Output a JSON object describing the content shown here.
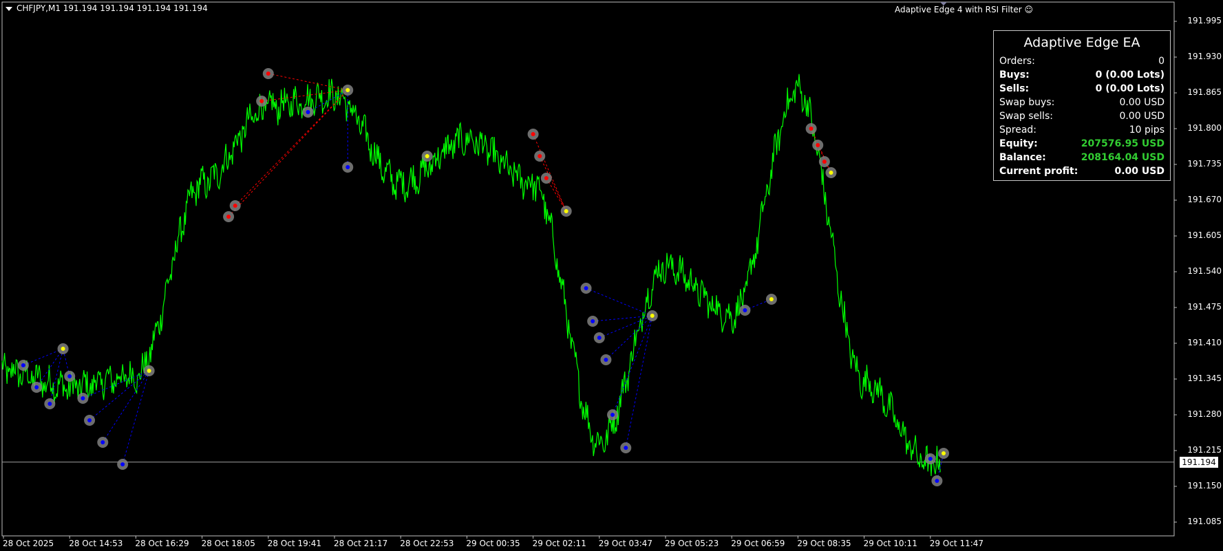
{
  "header": {
    "symbol_line": "CHFJPY,M1  191.194 191.194 191.194 191.194",
    "ea_name": "Adaptive Edge 4 with RSI Filter ☺"
  },
  "panel": {
    "title": "Adaptive Edge EA",
    "rows": [
      {
        "label": "Orders:",
        "value": "0",
        "bold": false,
        "green": false
      },
      {
        "label": "Buys:",
        "value": "0 (0.00 Lots)",
        "bold": true,
        "green": false
      },
      {
        "label": "Sells:",
        "value": "0 (0.00 Lots)",
        "bold": true,
        "green": false
      },
      {
        "label": "Swap buys:",
        "value": "0.00 USD",
        "bold": false,
        "green": false
      },
      {
        "label": "Swap sells:",
        "value": "0.00 USD",
        "bold": false,
        "green": false
      },
      {
        "label": "Spread:",
        "value": "10 pips",
        "bold": false,
        "green": false
      },
      {
        "label": "Equity:",
        "value": "207576.95 USD",
        "bold": true,
        "green": true
      },
      {
        "label": "Balance:",
        "value": "208164.04 USD",
        "bold": true,
        "green": true
      },
      {
        "label": "Current profit:",
        "value": "0.00 USD",
        "bold": true,
        "green": false
      }
    ]
  },
  "price_axis": [
    "191.995",
    "191.930",
    "191.865",
    "191.800",
    "191.735",
    "191.670",
    "191.605",
    "191.540",
    "191.475",
    "191.410",
    "191.345",
    "191.280",
    "191.215",
    "191.150",
    "191.085"
  ],
  "current_price": "191.194",
  "time_axis": [
    "28 Oct 2025",
    "28 Oct 14:53",
    "28 Oct 16:29",
    "28 Oct 18:05",
    "28 Oct 19:41",
    "28 Oct 21:17",
    "28 Oct 22:53",
    "29 Oct 00:35",
    "29 Oct 02:11",
    "29 Oct 03:47",
    "29 Oct 05:23",
    "29 Oct 06:59",
    "29 Oct 08:35",
    "29 Oct 10:11",
    "29 Oct 11:47"
  ],
  "colors": {
    "background": "#000000",
    "price_line": "#00ff00",
    "buy_marker": "#0000ff",
    "sell_marker": "#ff0000",
    "close_marker": "#ffff00",
    "marker_ring": "#808080",
    "axis": "#c0c0c0"
  },
  "chart_data": {
    "type": "line",
    "symbol": "CHFJPY",
    "timeframe": "M1",
    "ylim": [
      191.06,
      192.03
    ],
    "x": [
      "28 Oct 2025",
      "28 Oct 14:53",
      "28 Oct 16:29",
      "28 Oct 18:05",
      "28 Oct 19:41",
      "28 Oct 21:17",
      "28 Oct 22:53",
      "29 Oct 00:35",
      "29 Oct 02:11",
      "29 Oct 03:47",
      "29 Oct 05:23",
      "29 Oct 06:59",
      "29 Oct 08:35",
      "29 Oct 10:11",
      "29 Oct 11:47"
    ],
    "series": [
      {
        "values": [
          191.36,
          191.33,
          191.35,
          191.7,
          191.84,
          191.86,
          191.7,
          191.78,
          191.7,
          191.23,
          191.55,
          191.46,
          191.87,
          191.34,
          191.19
        ]
      }
    ],
    "current_price": 191.194,
    "trade_markers": {
      "buy": [
        [
          0.3,
          191.37
        ],
        [
          0.5,
          191.33
        ],
        [
          0.7,
          191.3
        ],
        [
          1.0,
          191.35
        ],
        [
          1.2,
          191.31
        ],
        [
          1.3,
          191.27
        ],
        [
          1.5,
          191.23
        ],
        [
          1.8,
          191.19
        ],
        [
          4.6,
          191.83
        ],
        [
          5.2,
          191.73
        ],
        [
          8.8,
          191.51
        ],
        [
          8.9,
          191.45
        ],
        [
          9.0,
          191.42
        ],
        [
          9.1,
          191.38
        ],
        [
          9.2,
          191.28
        ],
        [
          9.4,
          191.22
        ],
        [
          11.2,
          191.47
        ],
        [
          14.0,
          191.2
        ],
        [
          14.1,
          191.16
        ]
      ],
      "sell": [
        [
          3.4,
          191.64
        ],
        [
          3.5,
          191.66
        ],
        [
          3.9,
          191.85
        ],
        [
          4.0,
          191.9
        ],
        [
          8.0,
          191.79
        ],
        [
          8.1,
          191.75
        ],
        [
          8.2,
          191.71
        ],
        [
          12.2,
          191.8
        ],
        [
          12.3,
          191.77
        ],
        [
          12.4,
          191.74
        ]
      ],
      "close": [
        [
          0.9,
          191.4
        ],
        [
          2.2,
          191.36
        ],
        [
          5.2,
          191.87
        ],
        [
          6.4,
          191.75
        ],
        [
          8.5,
          191.65
        ],
        [
          9.8,
          191.46
        ],
        [
          11.6,
          191.49
        ],
        [
          12.5,
          191.72
        ],
        [
          14.2,
          191.21
        ]
      ]
    }
  }
}
